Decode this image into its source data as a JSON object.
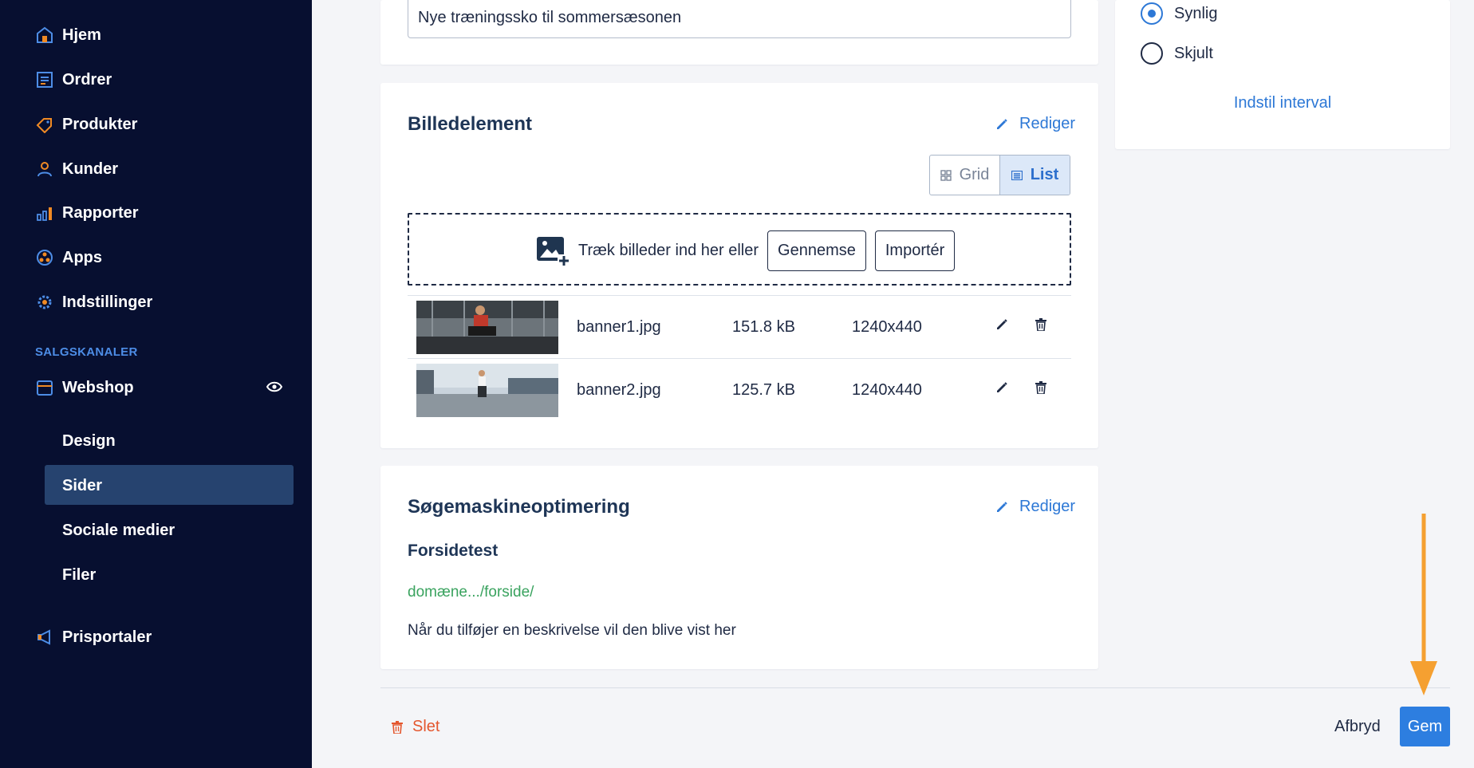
{
  "sidebar": {
    "items": [
      {
        "label": "Hjem",
        "icon": "home-icon"
      },
      {
        "label": "Ordrer",
        "icon": "orders-icon"
      },
      {
        "label": "Produkter",
        "icon": "tag-icon"
      },
      {
        "label": "Kunder",
        "icon": "user-icon"
      },
      {
        "label": "Rapporter",
        "icon": "bar-chart-icon"
      },
      {
        "label": "Apps",
        "icon": "apps-icon"
      },
      {
        "label": "Indstillinger",
        "icon": "gear-icon"
      }
    ],
    "section_label": "SALGSKANALER",
    "channel": {
      "label": "Webshop",
      "icon": "store-icon",
      "view_icon": "eye-icon"
    },
    "sub_items": [
      "Design",
      "Sider",
      "Sociale medier",
      "Filer"
    ],
    "active_sub_item": "Sider",
    "bottom_item": {
      "label": "Prisportaler",
      "icon": "megaphone-icon"
    }
  },
  "top_input": {
    "value": "Nye træningssko til sommersæsonen"
  },
  "image_card": {
    "title": "Billedelement",
    "edit_label": "Rediger",
    "view_toggle": {
      "grid_label": "Grid",
      "list_label": "List",
      "selected": "List"
    },
    "dropzone": {
      "text": "Træk billeder ind her eller",
      "browse_label": "Gennemse",
      "import_label": "Importér"
    },
    "files": [
      {
        "name": "banner1.jpg",
        "size": "151.8 kB",
        "dimensions": "1240x440"
      },
      {
        "name": "banner2.jpg",
        "size": "125.7 kB",
        "dimensions": "1240x440"
      }
    ]
  },
  "seo_card": {
    "title": "Søgemaskineoptimering",
    "edit_label": "Rediger",
    "page_title": "Forsidetest",
    "url": "domæne.../forside/",
    "description": "Når du tilføjer en beskrivelse vil den blive vist her"
  },
  "visibility_card": {
    "options": [
      "Synlig",
      "Skjult"
    ],
    "selected": "Synlig",
    "interval_label": "Indstil interval"
  },
  "footer": {
    "delete_label": "Slet",
    "cancel_label": "Afbryd",
    "save_label": "Gem"
  },
  "colors": {
    "sidebar_bg": "#070f30",
    "accent": "#2d78d6",
    "danger": "#e4572e",
    "seo_url": "#3aa35f",
    "annotation_arrow": "#f5a031"
  }
}
